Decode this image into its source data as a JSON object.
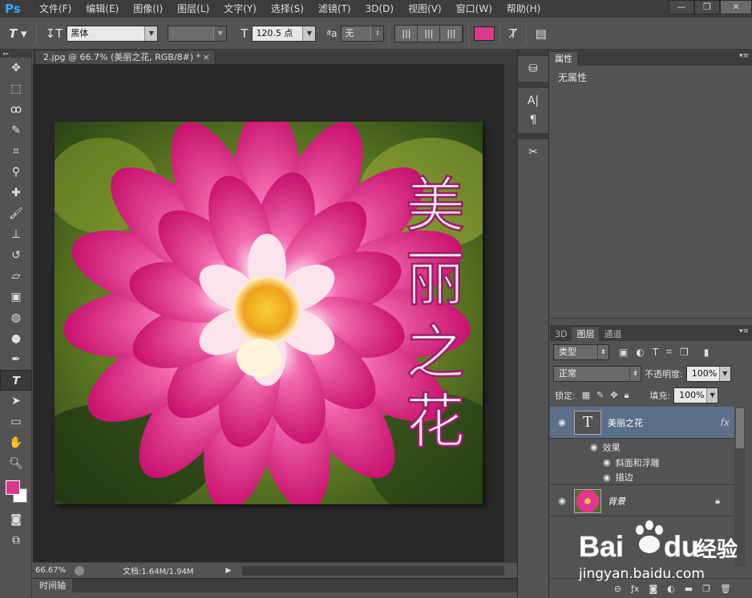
{
  "app": {
    "logo": "Ps"
  },
  "menu": [
    "文件(F)",
    "编辑(E)",
    "图像(I)",
    "图层(L)",
    "文字(Y)",
    "选择(S)",
    "滤镜(T)",
    "3D(D)",
    "视图(V)",
    "窗口(W)",
    "帮助(H)"
  ],
  "window_controls": {
    "minimize": "—",
    "restore": "❐",
    "close": "✕"
  },
  "options": {
    "font_family": "黑体",
    "font_style": "-",
    "font_size": "120.5 点",
    "aa_label": "ªa",
    "antialias": "无",
    "color": "#d8398c"
  },
  "document": {
    "tab_title": "2.jpg @ 66.7% (美丽之花, RGB/8#) *",
    "zoom": "66.67%",
    "doc_info": "文档:1.64M/1.94M",
    "vertical_text": "美丽之花"
  },
  "timeline": {
    "label": "时间轴"
  },
  "tool_colors": {
    "foreground": "#d8398c",
    "background": "#ffffff"
  },
  "panels": {
    "properties": {
      "tab": "属性",
      "message": "无属性"
    },
    "layer_tabs": [
      "3D",
      "图层",
      "通道"
    ],
    "filter_kind": "类型",
    "blend_mode": "正常",
    "opacity_label": "不透明度:",
    "opacity": "100%",
    "lock_label": "锁定:",
    "fill_label": "填充:",
    "fill": "100%"
  },
  "layers": [
    {
      "name": "美丽之花",
      "thumb": "T",
      "fx": "fx",
      "effects_label": "效果",
      "effects": [
        "斜面和浮雕",
        "描边"
      ]
    },
    {
      "name": "背景"
    }
  ],
  "watermark": {
    "brand": "Bai",
    "brand2": "du",
    "cn": "经验",
    "url": "jingyan.baidu.com"
  }
}
